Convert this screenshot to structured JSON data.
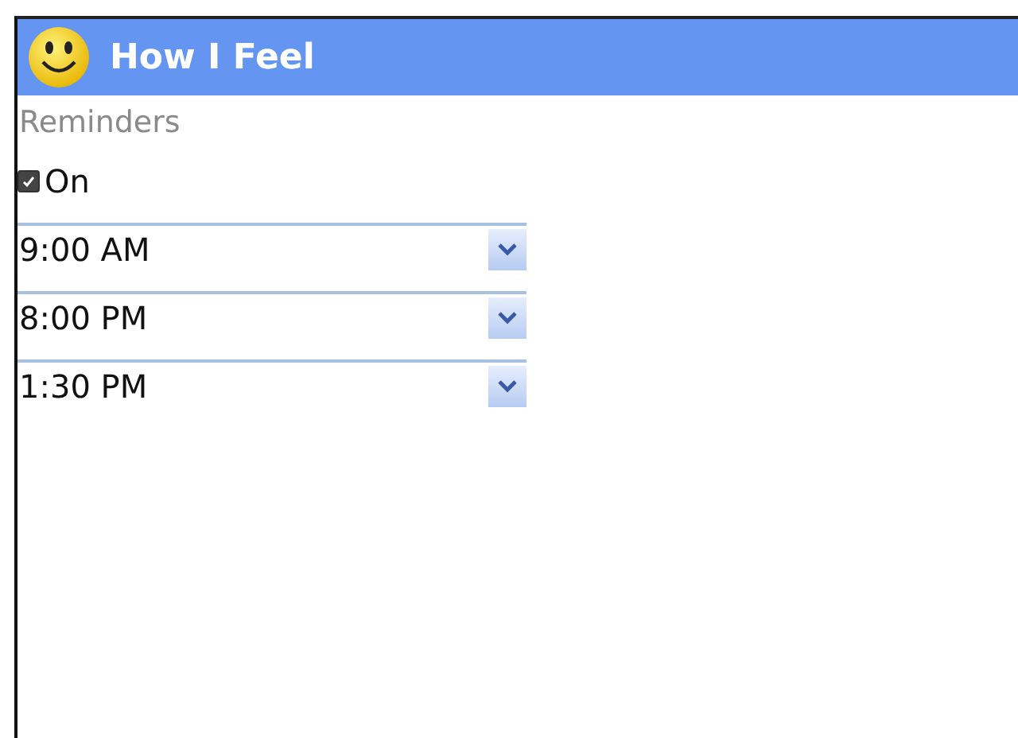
{
  "app": {
    "title": "How I Feel"
  },
  "section": {
    "title": "Reminders"
  },
  "toggle": {
    "label": "On",
    "checked": true
  },
  "times": [
    {
      "value": "9:00 AM"
    },
    {
      "value": "8:00 PM"
    },
    {
      "value": "1:30 PM"
    }
  ]
}
